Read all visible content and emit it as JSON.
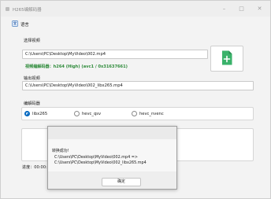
{
  "window": {
    "title": "H265编解码器"
  },
  "menu": {
    "language": "语言"
  },
  "input": {
    "label": "选择视频",
    "path": "C:\\Users\\PC\\Desktop\\MyVideo\\002.mp4",
    "codec_info": "视频编解码器：h264 (High) (avc1 / 0x31637661)"
  },
  "output": {
    "label": "输出视频",
    "path": "C:\\Users\\PC\\Desktop\\MyVideo\\002_libx265.mp4"
  },
  "encoder": {
    "label": "编解码器",
    "options": [
      "libx265",
      "hevc_qsv",
      "hevc_nvenc"
    ],
    "selected": "libx265"
  },
  "progress": {
    "label": "进度：00:00:13"
  },
  "dialog": {
    "message": "转换成功!",
    "line1": "C:\\Users\\PC\\Desktop\\MyVideo\\002.mp4 =>",
    "line2": "C:\\Users\\PC\\Desktop\\MyVideo\\002_libx265.mp4",
    "ok": "确定"
  },
  "colors": {
    "accent": "#0067c0",
    "success": "#2e8b3a",
    "add_icon": "#3ab26a"
  }
}
